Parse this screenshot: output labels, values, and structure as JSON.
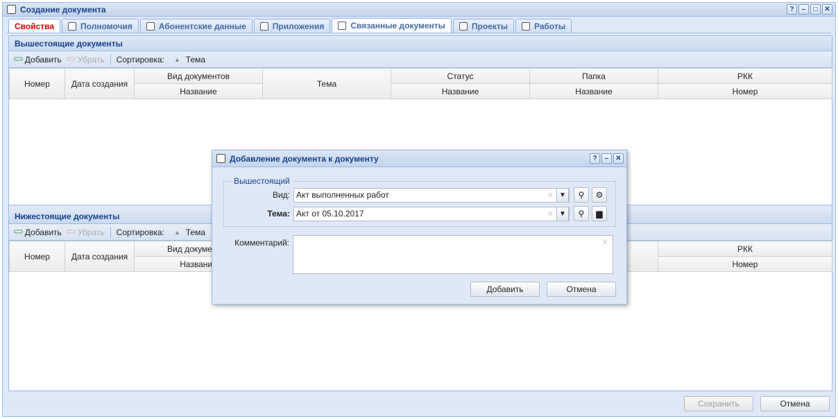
{
  "window": {
    "title": "Создание документа",
    "tools": [
      "?",
      "–",
      "□",
      "✕"
    ]
  },
  "tabs": [
    {
      "label": "Свойства"
    },
    {
      "label": "Полномочия"
    },
    {
      "label": "Абонентские данные"
    },
    {
      "label": "Приложения"
    },
    {
      "label": "Связанные документы"
    },
    {
      "label": "Проекты"
    },
    {
      "label": "Работы"
    }
  ],
  "upper": {
    "title": "Вышестоящие документы",
    "toolbar": {
      "add": "Добавить",
      "remove": "Убрать",
      "sort_label": "Сортировка:",
      "sort_field": "Тема"
    },
    "columns": {
      "number": "Номер",
      "created": "Дата создания",
      "doctype_group": "Вид документов",
      "doctype_name": "Название",
      "subject": "Тема",
      "status_group": "Статус",
      "status_name": "Название",
      "folder_group": "Папка",
      "folder_name": "Название",
      "rkk_group": "РКК",
      "rkk_number": "Номер"
    }
  },
  "lower": {
    "title": "Нижестоящие документы",
    "toolbar": {
      "add": "Добавить",
      "remove": "Убрать",
      "sort_label": "Сортировка:",
      "sort_field": "Тема"
    },
    "columns": {
      "number": "Номер",
      "created": "Дата создания",
      "doctype_group": "Вид документов",
      "doctype_name": "Название",
      "rkk_group": "РКК",
      "rkk_number": "Номер"
    }
  },
  "footer": {
    "save": "Сохранить",
    "cancel": "Отмена"
  },
  "dialog": {
    "title": "Добавление документа к документу",
    "tools": [
      "?",
      "–",
      "✕"
    ],
    "group_label": "Вышестоящий",
    "kind_label": "Вид:",
    "kind_value": "Акт выполненных работ",
    "subject_label": "Тема:",
    "subject_value": "Акт от 05.10.2017",
    "comment_label": "Комментарий:",
    "add_button": "Добавить",
    "cancel_button": "Отмена"
  }
}
